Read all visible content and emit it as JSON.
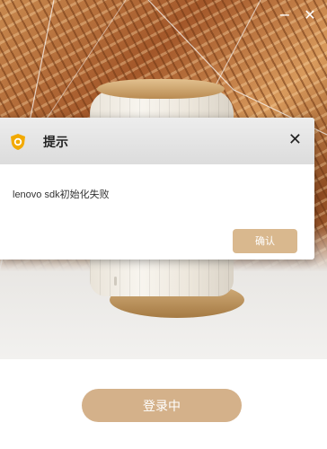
{
  "window": {
    "minimize_glyph": "−",
    "close_glyph": "✕"
  },
  "hero": {
    "image": "router-product-photo"
  },
  "dialog": {
    "title": "提示",
    "icon": "shield-logo-icon",
    "close_glyph": "✕",
    "message": "lenovo sdk初始化失败",
    "confirm_label": "确认"
  },
  "login": {
    "button_label": "登录中"
  },
  "colors": {
    "accent": "#d4b18a",
    "logo": "#f2a900"
  }
}
